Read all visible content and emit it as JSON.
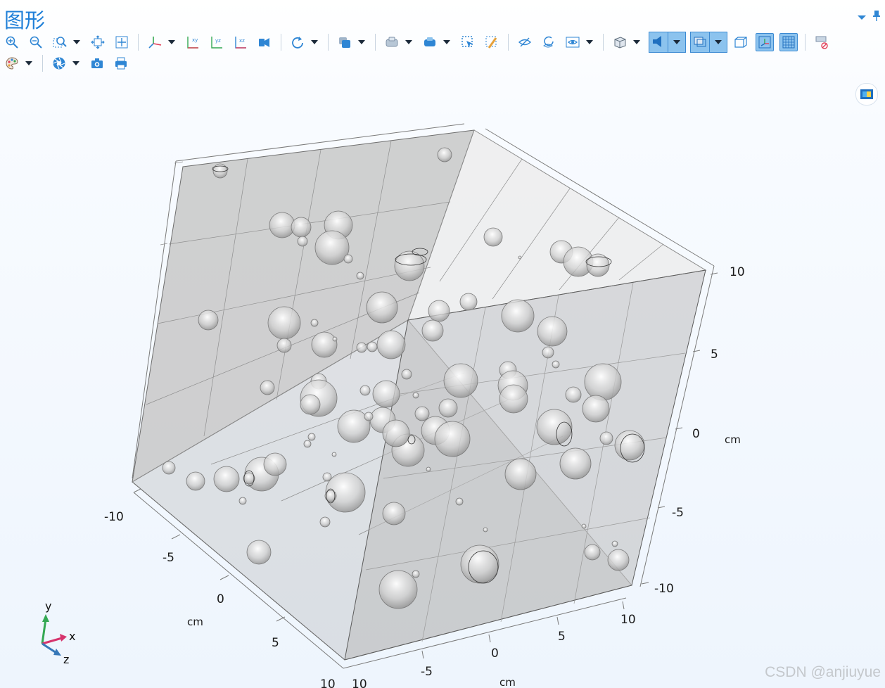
{
  "window": {
    "title": "图形"
  },
  "toolbar": {
    "buttons": [
      {
        "id": "zoom-in",
        "icon": "zoom-in-icon"
      },
      {
        "id": "zoom-out",
        "icon": "zoom-out-icon"
      },
      {
        "id": "zoom-box",
        "icon": "zoom-box-icon",
        "dropdown": true
      },
      {
        "id": "zoom-extents",
        "icon": "zoom-extents-icon"
      },
      {
        "id": "go-to-default-view",
        "icon": "default-view-icon"
      },
      {
        "id": "axes-orientation",
        "icon": "axes-orientation-icon",
        "dropdown": true
      },
      {
        "id": "view-xy",
        "icon": "xy-plane-icon"
      },
      {
        "id": "view-yz",
        "icon": "yz-plane-icon"
      },
      {
        "id": "view-xz",
        "icon": "xz-plane-icon"
      },
      {
        "id": "camera-view",
        "icon": "camera-view-icon"
      },
      {
        "id": "rotate",
        "icon": "rotate-icon",
        "dropdown": true
      },
      {
        "id": "select-objects",
        "icon": "select-objects-icon",
        "dropdown": true
      },
      {
        "id": "select-domains",
        "icon": "select-domains-icon",
        "dropdown": true
      },
      {
        "id": "select-boundaries",
        "icon": "select-boundaries-icon",
        "dropdown": true
      },
      {
        "id": "select-box",
        "icon": "select-box-icon"
      },
      {
        "id": "clear-selection",
        "icon": "clear-selection-icon"
      },
      {
        "id": "hide-selected",
        "icon": "hide-icon"
      },
      {
        "id": "reset-hiding",
        "icon": "reset-hiding-icon"
      },
      {
        "id": "show-options",
        "icon": "eye-icon",
        "dropdown": true
      },
      {
        "id": "wireframe-render",
        "icon": "wireframe-icon",
        "dropdown": true
      },
      {
        "id": "lighting",
        "icon": "light-icon",
        "active": true,
        "split": true
      },
      {
        "id": "transparency",
        "icon": "transparency-icon",
        "active": true,
        "split": true
      },
      {
        "id": "wireframe",
        "icon": "wireframe-box-icon"
      },
      {
        "id": "show-axis",
        "icon": "axis-icon",
        "active": true
      },
      {
        "id": "show-grid",
        "icon": "grid-icon",
        "active": true
      },
      {
        "id": "scene-light",
        "icon": "scene-light-icon"
      }
    ],
    "row2": [
      {
        "id": "color-table",
        "icon": "palette-icon",
        "dropdown": true
      },
      {
        "id": "screenshot-aperture",
        "icon": "aperture-icon",
        "dropdown": true
      },
      {
        "id": "image-snapshot",
        "icon": "camera-icon"
      },
      {
        "id": "print",
        "icon": "printer-icon"
      }
    ]
  },
  "axes": {
    "unit": "cm",
    "x_ticks": [
      "-5",
      "0",
      "5",
      "10"
    ],
    "y_ticks": [
      "-10",
      "-5",
      "0",
      "5",
      "10"
    ],
    "z_ticks": [
      "-10",
      "-5",
      "0",
      "5",
      "10"
    ],
    "x_cut_label": "10",
    "z_cut_label": "10"
  },
  "triad": {
    "x": "x",
    "y": "y",
    "z": "z"
  },
  "watermark": "CSDN @anjiuyue"
}
